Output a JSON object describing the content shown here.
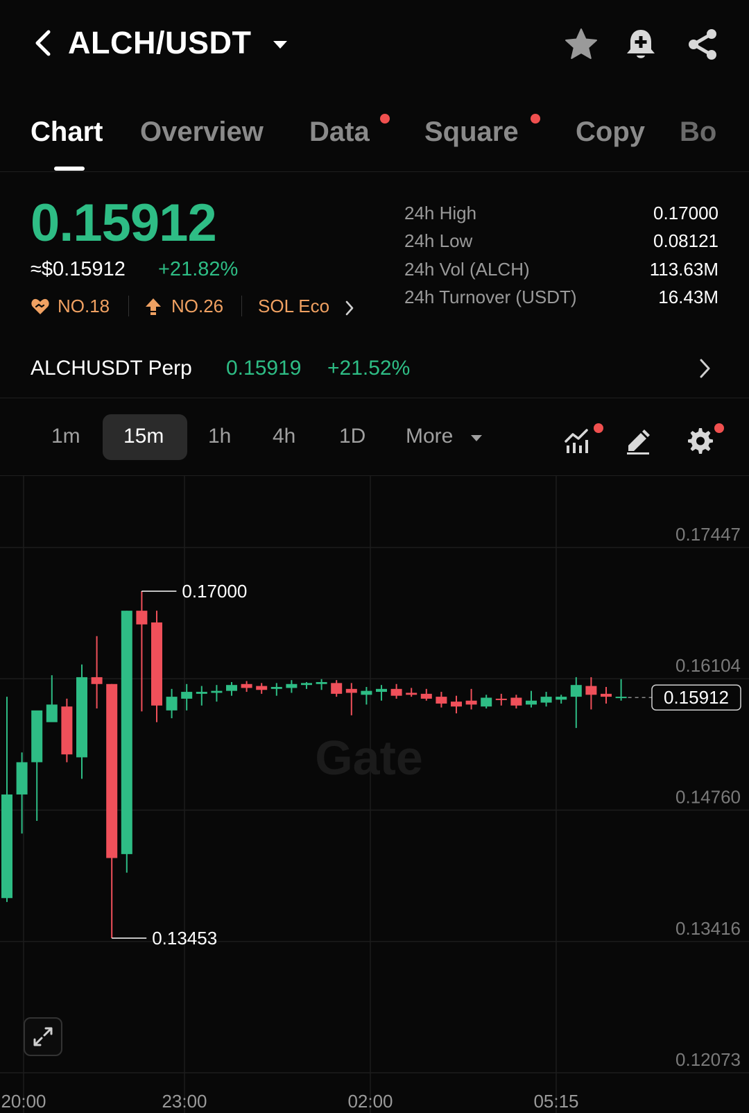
{
  "header": {
    "title": "ALCH/USDT"
  },
  "tabs": [
    {
      "label": "Chart",
      "active": true,
      "dot": false
    },
    {
      "label": "Overview",
      "active": false,
      "dot": false
    },
    {
      "label": "Data",
      "active": false,
      "dot": true
    },
    {
      "label": "Square",
      "active": false,
      "dot": true
    },
    {
      "label": "Copy",
      "active": false,
      "dot": false
    },
    {
      "label": "Bo",
      "active": false,
      "dot": false
    }
  ],
  "price": {
    "last": "0.15912",
    "usd": "≈$0.15912",
    "change": "+21.82%",
    "ranks": [
      {
        "icon": "heart-handshake-icon",
        "label": "NO.18"
      },
      {
        "icon": "arrow-up-icon",
        "label": "NO.26"
      },
      {
        "icon": "",
        "label": "SOL Eco"
      }
    ]
  },
  "stats": [
    {
      "label": "24h High",
      "value": "0.17000"
    },
    {
      "label": "24h Low",
      "value": "0.08121"
    },
    {
      "label": "24h Vol (ALCH)",
      "value": "113.63M"
    },
    {
      "label": "24h Turnover (USDT)",
      "value": "16.43M"
    }
  ],
  "perp": {
    "label": "ALCHUSDT Perp",
    "price": "0.15919",
    "change": "+21.52%"
  },
  "intervals": {
    "items": [
      "1m",
      "15m",
      "1h",
      "4h",
      "1D"
    ],
    "selected": "15m",
    "more_label": "More"
  },
  "colors": {
    "up": "#2ebd85",
    "down": "#f0505a",
    "accent_dot": "#f0504f",
    "rank": "#f0a162"
  },
  "chart_data": {
    "type": "candlestick",
    "watermark": "Gate",
    "x_ticks": [
      "20:00",
      "23:00",
      "02:00",
      "05:15"
    ],
    "y_ticks": [
      "0.17447",
      "0.16104",
      "0.14760",
      "0.13416",
      "0.12073"
    ],
    "ylim": [
      0.12073,
      0.17447
    ],
    "annotations": {
      "high": "0.17000",
      "low": "0.13453"
    },
    "last_price_label": "0.15912",
    "candles": [
      {
        "o": 0.1386,
        "h": 0.1592,
        "l": 0.1382,
        "c": 0.1492
      },
      {
        "o": 0.1492,
        "h": 0.1535,
        "l": 0.1452,
        "c": 0.1525
      },
      {
        "o": 0.1525,
        "h": 0.1568,
        "l": 0.1465,
        "c": 0.1578
      },
      {
        "o": 0.1566,
        "h": 0.1614,
        "l": 0.1578,
        "c": 0.1584
      },
      {
        "o": 0.1582,
        "h": 0.159,
        "l": 0.1525,
        "c": 0.1533
      },
      {
        "o": 0.153,
        "h": 0.1625,
        "l": 0.1508,
        "c": 0.1612
      },
      {
        "o": 0.1612,
        "h": 0.1654,
        "l": 0.158,
        "c": 0.1605
      },
      {
        "o": 0.1605,
        "h": 0.1605,
        "l": 0.1345,
        "c": 0.1427
      },
      {
        "o": 0.1431,
        "h": 0.168,
        "l": 0.1412,
        "c": 0.168
      },
      {
        "o": 0.168,
        "h": 0.17,
        "l": 0.1577,
        "c": 0.1666
      },
      {
        "o": 0.1668,
        "h": 0.168,
        "l": 0.1566,
        "c": 0.1583
      },
      {
        "o": 0.1578,
        "h": 0.16,
        "l": 0.157,
        "c": 0.1592
      },
      {
        "o": 0.159,
        "h": 0.1605,
        "l": 0.1578,
        "c": 0.1597
      },
      {
        "o": 0.1595,
        "h": 0.1603,
        "l": 0.1583,
        "c": 0.1597
      },
      {
        "o": 0.1596,
        "h": 0.1604,
        "l": 0.1587,
        "c": 0.1598
      },
      {
        "o": 0.1598,
        "h": 0.1607,
        "l": 0.1593,
        "c": 0.1604
      },
      {
        "o": 0.1605,
        "h": 0.1608,
        "l": 0.1597,
        "c": 0.1601
      },
      {
        "o": 0.1603,
        "h": 0.1606,
        "l": 0.1595,
        "c": 0.1599
      },
      {
        "o": 0.16,
        "h": 0.1606,
        "l": 0.1593,
        "c": 0.1602
      },
      {
        "o": 0.1601,
        "h": 0.1609,
        "l": 0.1596,
        "c": 0.1605
      },
      {
        "o": 0.1604,
        "h": 0.1607,
        "l": 0.16,
        "c": 0.1606
      },
      {
        "o": 0.1605,
        "h": 0.161,
        "l": 0.1599,
        "c": 0.1607
      },
      {
        "o": 0.1606,
        "h": 0.1609,
        "l": 0.1592,
        "c": 0.1595
      },
      {
        "o": 0.16,
        "h": 0.1606,
        "l": 0.1573,
        "c": 0.1596
      },
      {
        "o": 0.1594,
        "h": 0.1602,
        "l": 0.1584,
        "c": 0.1598
      },
      {
        "o": 0.1597,
        "h": 0.1604,
        "l": 0.1588,
        "c": 0.16
      },
      {
        "o": 0.16,
        "h": 0.1605,
        "l": 0.159,
        "c": 0.1593
      },
      {
        "o": 0.1596,
        "h": 0.1601,
        "l": 0.1592,
        "c": 0.1594
      },
      {
        "o": 0.1595,
        "h": 0.16,
        "l": 0.1588,
        "c": 0.159
      },
      {
        "o": 0.1592,
        "h": 0.1597,
        "l": 0.1581,
        "c": 0.1585
      },
      {
        "o": 0.1587,
        "h": 0.1593,
        "l": 0.1575,
        "c": 0.1582
      },
      {
        "o": 0.1588,
        "h": 0.16,
        "l": 0.1579,
        "c": 0.1584
      },
      {
        "o": 0.1582,
        "h": 0.1594,
        "l": 0.158,
        "c": 0.1591
      },
      {
        "o": 0.159,
        "h": 0.1595,
        "l": 0.1583,
        "c": 0.1589
      },
      {
        "o": 0.1591,
        "h": 0.1594,
        "l": 0.158,
        "c": 0.1583
      },
      {
        "o": 0.1584,
        "h": 0.1598,
        "l": 0.1581,
        "c": 0.1588
      },
      {
        "o": 0.1586,
        "h": 0.1597,
        "l": 0.1582,
        "c": 0.1592
      },
      {
        "o": 0.1589,
        "h": 0.1594,
        "l": 0.1585,
        "c": 0.1592
      },
      {
        "o": 0.1592,
        "h": 0.1612,
        "l": 0.156,
        "c": 0.1604
      },
      {
        "o": 0.1603,
        "h": 0.1612,
        "l": 0.1579,
        "c": 0.1594
      },
      {
        "o": 0.1595,
        "h": 0.1602,
        "l": 0.1585,
        "c": 0.1592
      },
      {
        "o": 0.1592,
        "h": 0.161,
        "l": 0.1588,
        "c": 0.1592
      }
    ]
  }
}
